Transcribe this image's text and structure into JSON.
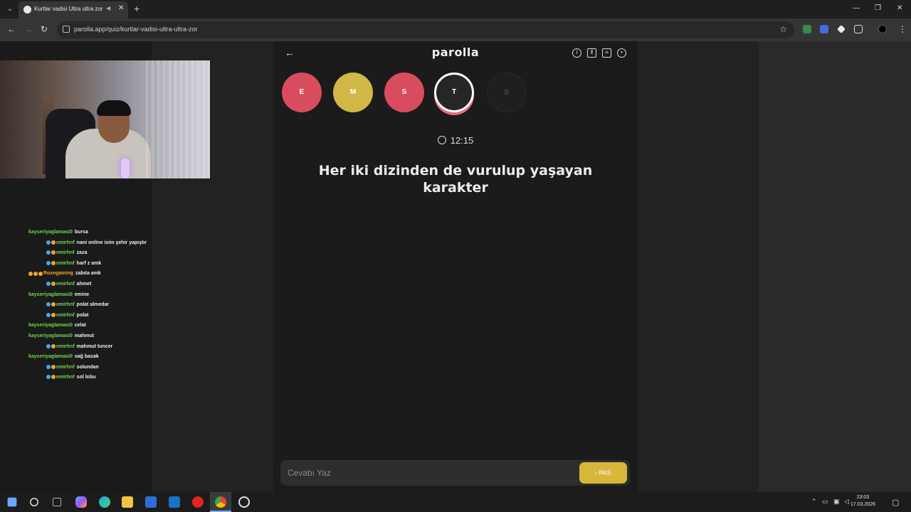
{
  "browser": {
    "tab_title": "Kurtlar vadisi Ultra ultra zor",
    "url": "parolla.app/quiz/kurtlar-vadisi-ultra-ultra-zor",
    "new_tab": "+",
    "tab_close": "✕",
    "win_min": "—",
    "win_max": "❐",
    "win_close": "✕"
  },
  "app": {
    "logo": "parolla",
    "letters": [
      {
        "letter": "E",
        "state": "wrong",
        "color": "#d94c5e"
      },
      {
        "letter": "M",
        "state": "passed",
        "color": "#d1b846"
      },
      {
        "letter": "S",
        "state": "wrong",
        "color": "#d94c5e"
      },
      {
        "letter": "T",
        "state": "active",
        "color": "#262626"
      },
      {
        "letter": "B",
        "state": "pending",
        "color": "#1f1f1f"
      }
    ],
    "timer": "12:15",
    "question": "Her iki dizinden de vurulup yaşayan karakter",
    "answer_placeholder": "Cevabı Yaz",
    "pass_label": "PAS"
  },
  "chat": [
    {
      "user": "kayseriyaglamasi0",
      "msg": "bursa",
      "color": "#6bd84a",
      "badges": []
    },
    {
      "user": "emirhnf",
      "msg": "nani online isim şehir yapıştır",
      "color": "#6bd84a",
      "badges": [
        "#3fa9f5",
        "#f5a623"
      ]
    },
    {
      "user": "emirhnf",
      "msg": "zaza",
      "color": "#6bd84a",
      "badges": [
        "#3fa9f5",
        "#f5a623"
      ]
    },
    {
      "user": "emirhnf",
      "msg": "harf z amk",
      "color": "#6bd84a",
      "badges": [
        "#3fa9f5",
        "#f5a623"
      ]
    },
    {
      "user": "Roxegaming",
      "msg": "zabıta amk",
      "color": "#f5a623",
      "badges": [
        "#f5a623",
        "#f5a623",
        "#f5a623"
      ]
    },
    {
      "user": "emirhnf",
      "msg": "ahmet",
      "color": "#6bd84a",
      "badges": [
        "#3fa9f5",
        "#f5a623"
      ]
    },
    {
      "user": "kayseriyaglamasi0",
      "msg": "emine",
      "color": "#6bd84a",
      "badges": []
    },
    {
      "user": "emirhnf",
      "msg": "polat almedar",
      "color": "#6bd84a",
      "badges": [
        "#3fa9f5",
        "#f5a623"
      ]
    },
    {
      "user": "emirhnf",
      "msg": "polat",
      "color": "#6bd84a",
      "badges": [
        "#3fa9f5",
        "#f5a623"
      ]
    },
    {
      "user": "kayseriyaglamasi0",
      "msg": "celat",
      "color": "#6bd84a",
      "badges": []
    },
    {
      "user": "kayseriyaglamasi0",
      "msg": "mahmut",
      "color": "#6bd84a",
      "badges": []
    },
    {
      "user": "emirhnf",
      "msg": "mahmut tuncer",
      "color": "#6bd84a",
      "badges": [
        "#3fa9f5",
        "#f5a623"
      ]
    },
    {
      "user": "kayseriyaglamasi0",
      "msg": "sağ bacak",
      "color": "#6bd84a",
      "badges": []
    },
    {
      "user": "emirhnf",
      "msg": "solundan",
      "color": "#6bd84a",
      "badges": [
        "#3fa9f5",
        "#f5a623"
      ]
    },
    {
      "user": "emirhnf",
      "msg": "sol lobu",
      "color": "#6bd84a",
      "badges": [
        "#3fa9f5",
        "#f5a623"
      ]
    }
  ],
  "taskbar": {
    "time": "23:03",
    "date": "17.03.2026"
  }
}
